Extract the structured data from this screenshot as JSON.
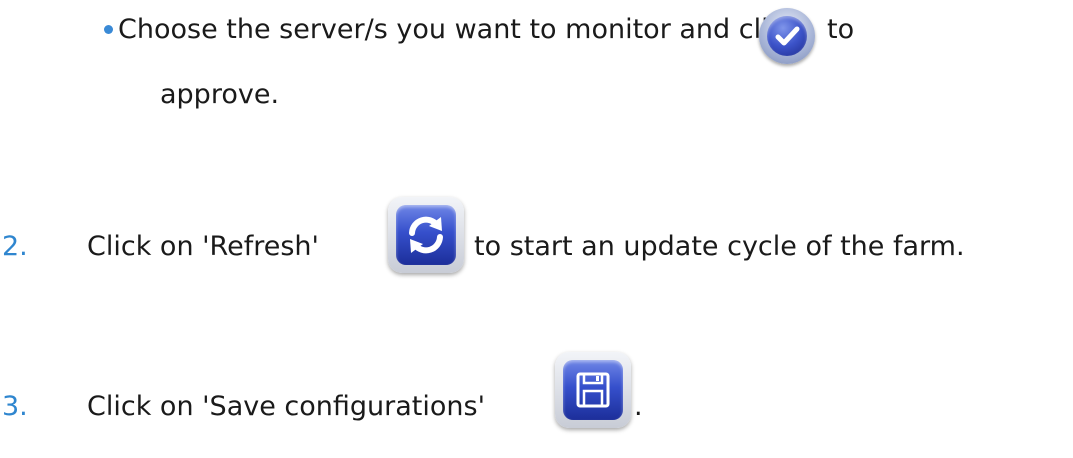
{
  "steps": {
    "bullet_text_before": "Choose the server/s you want to monitor and click",
    "bullet_text_after": "to",
    "bullet_text_continued": "approve.",
    "step2": {
      "number": "2.",
      "text_before": "Click on 'Refresh'",
      "text_after": "to start an update cycle of the farm."
    },
    "step3": {
      "number": "3.",
      "text_before": "Click on 'Save configurations'",
      "text_after": "."
    }
  },
  "icons": {
    "approve": "check-circle-icon",
    "refresh": "refresh-icon",
    "save": "floppy-disk-icon"
  },
  "colors": {
    "step_number": "#2f86cf",
    "bullet": "#3a8ad6",
    "icon_blue": "#3650cc"
  }
}
